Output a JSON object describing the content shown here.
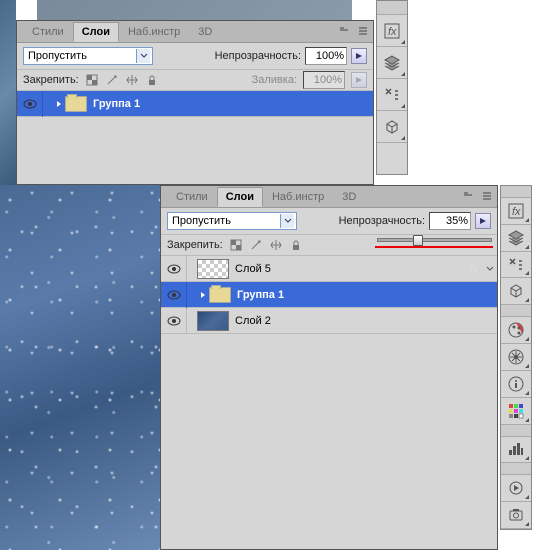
{
  "panel1": {
    "tabs": [
      "Стили",
      "Слои",
      "Наб.инстр",
      "3D"
    ],
    "active_tab": "Слои",
    "blend_mode": "Пропустить",
    "opacity_label": "Непрозрачность:",
    "opacity_value": "100%",
    "lock_label": "Закрепить:",
    "fill_label": "Заливка:",
    "fill_value": "100%",
    "layers": [
      {
        "name": "Группа 1",
        "type": "group",
        "selected": true
      }
    ]
  },
  "panel2": {
    "tabs": [
      "Стили",
      "Слои",
      "Наб.инстр",
      "3D"
    ],
    "active_tab": "Слои",
    "blend_mode": "Пропустить",
    "opacity_label": "Непрозрачность:",
    "opacity_value": "35%",
    "lock_label": "Закрепить:",
    "layers": [
      {
        "name": "Слой 5",
        "type": "layer",
        "selected": false,
        "fx": true,
        "thumb": "checker"
      },
      {
        "name": "Группа 1",
        "type": "group",
        "selected": true
      },
      {
        "name": "Слой 2",
        "type": "layer",
        "selected": false,
        "thumb": "winter"
      }
    ],
    "slider_percent": 35
  },
  "icons": {
    "fx": "fx",
    "layers_stack": "layers",
    "tools": "tools",
    "history": "history",
    "wand": "wand",
    "color": "color",
    "compass": "compass",
    "info": "info",
    "swatches": "swatches",
    "grid": "grid",
    "gear": "gear",
    "camera": "camera"
  }
}
